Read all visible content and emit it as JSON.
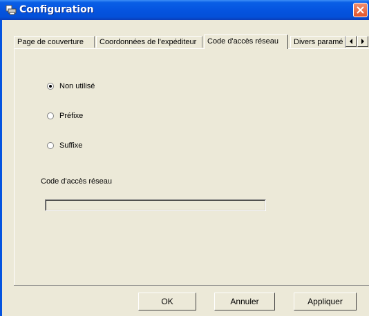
{
  "window": {
    "title": "Configuration",
    "close_icon": "close-icon"
  },
  "tabs": [
    {
      "label": "Page de couverture",
      "active": false
    },
    {
      "label": "Coordonnées de l'expéditeur",
      "active": false
    },
    {
      "label": "Code d'accès réseau",
      "active": true
    },
    {
      "label": "Divers paramé",
      "active": false
    }
  ],
  "tab_scroll": {
    "left_icon": "arrow-left-icon",
    "right_icon": "arrow-right-icon"
  },
  "options": [
    {
      "label": "Non utilisé",
      "checked": true
    },
    {
      "label": "Préfixe",
      "checked": false
    },
    {
      "label": "Suffixe",
      "checked": false
    }
  ],
  "access_code": {
    "label": "Code d'accès réseau",
    "value": ""
  },
  "buttons": {
    "ok": "OK",
    "cancel": "Annuler",
    "apply": "Appliquer"
  }
}
